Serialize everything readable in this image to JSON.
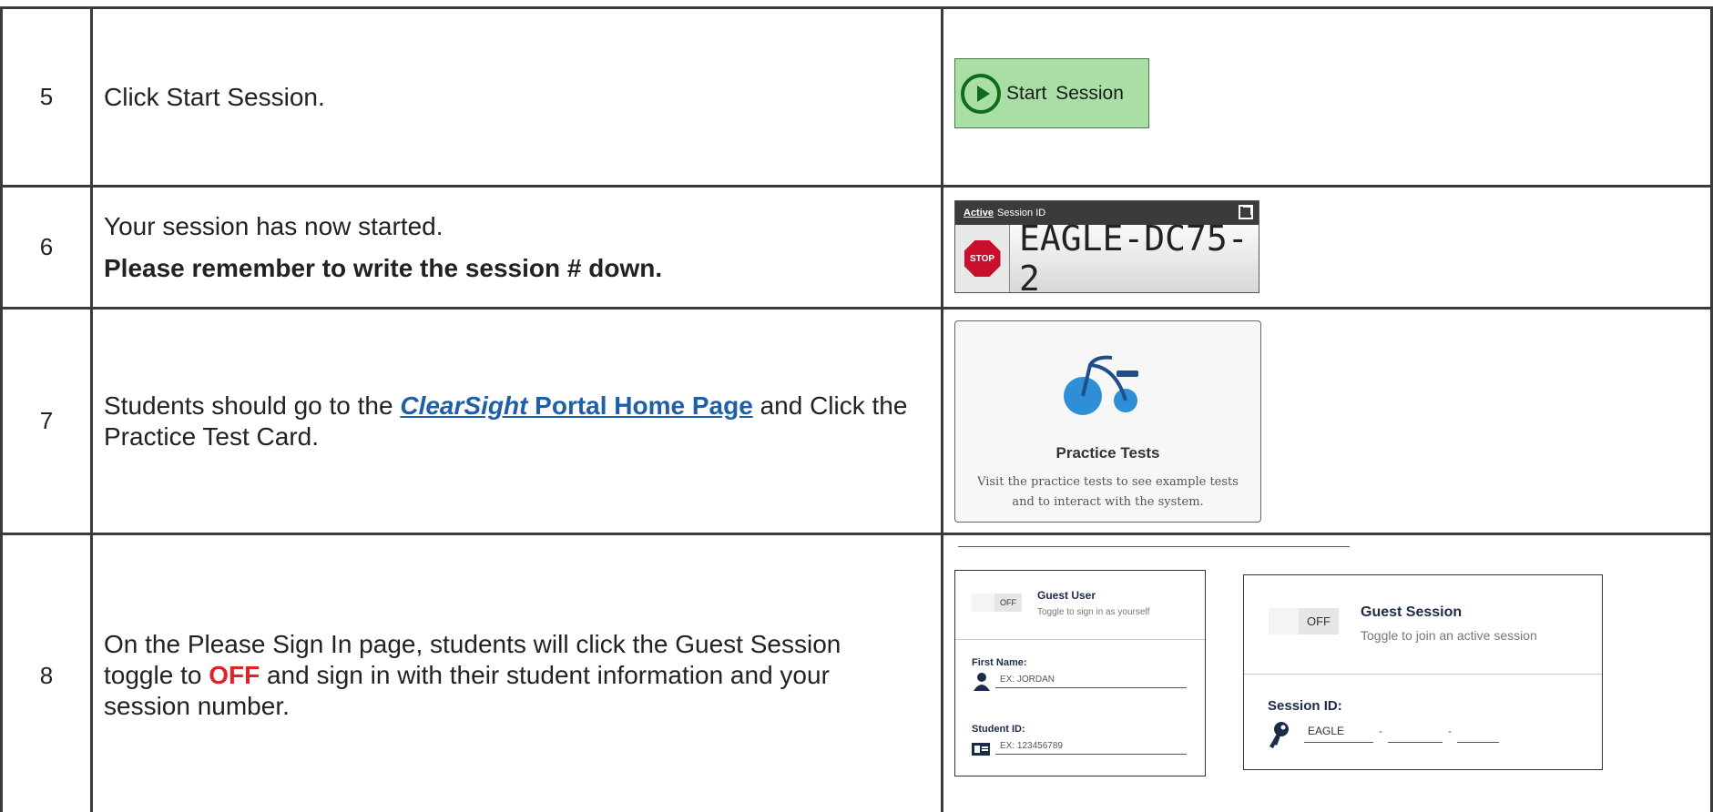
{
  "rows": [
    {
      "number": "5",
      "instruction": "Click Start Session."
    },
    {
      "number": "6",
      "line1": "Your session has now started.",
      "line2": "Please remember to write the session # down."
    },
    {
      "number": "7",
      "pre": "Students should go to the ",
      "link_italic": "ClearSight",
      "link_rest": " Portal Home Page",
      "post": " and Click the Practice Test Card."
    },
    {
      "number": "8",
      "pre": "On the Please Sign In page, students will click the Guest Session toggle to ",
      "highlight": "OFF",
      "post": " and sign in with their student information and your session number."
    }
  ],
  "start_button": {
    "label": "Start  Session",
    "icon": "play-circle-icon"
  },
  "active_session": {
    "active_label": "Active",
    "header_label": "Session ID",
    "stop_label": "STOP",
    "session_id": "EAGLE-DC75-2"
  },
  "practice_card": {
    "title": "Practice Tests",
    "description": "Visit the practice tests to see example tests and to interact with the system.",
    "icon": "tricycle-icon"
  },
  "guest_user": {
    "toggle": "OFF",
    "title": "Guest User",
    "subtitle": "Toggle to sign in as yourself",
    "first_name_label": "First Name:",
    "first_name_placeholder": "EX: JORDAN",
    "student_id_label": "Student ID:",
    "student_id_placeholder": "EX: 123456789"
  },
  "guest_session": {
    "toggle": "OFF",
    "title": "Guest Session",
    "subtitle": "Toggle to join an active session",
    "session_label": "Session ID:",
    "segment1": "EAGLE",
    "separator": "-"
  },
  "colors": {
    "link": "#1e5fa8",
    "highlight": "#e0232b",
    "button_green": "#a9dfa5",
    "icon_blue": "#2e8fd6"
  }
}
